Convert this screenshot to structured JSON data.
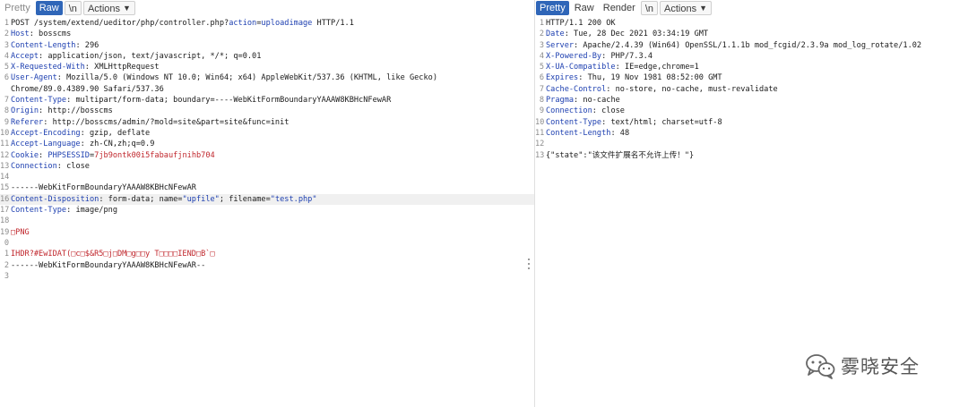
{
  "request": {
    "tabs": [
      "Pretty",
      "Raw",
      "\\n",
      "Actions"
    ],
    "active_tab": "Raw",
    "lines": [
      {
        "n": "1",
        "segs": [
          {
            "t": "POST /system/extend/ueditor/php/controller.php?"
          },
          {
            "t": "action",
            "c": "qv"
          },
          {
            "t": "="
          },
          {
            "t": "uploadimage",
            "c": "qv"
          },
          {
            "t": " HTTP/1.1"
          }
        ]
      },
      {
        "n": "2",
        "segs": [
          {
            "t": "Host",
            "c": "hn"
          },
          {
            "t": ": bosscms"
          }
        ]
      },
      {
        "n": "3",
        "segs": [
          {
            "t": "Content-Length",
            "c": "hn"
          },
          {
            "t": ": 296"
          }
        ]
      },
      {
        "n": "4",
        "segs": [
          {
            "t": "Accept",
            "c": "hn"
          },
          {
            "t": ": application/json, text/javascript, */*; q=0.01"
          }
        ]
      },
      {
        "n": "5",
        "segs": [
          {
            "t": "X-Requested-With",
            "c": "hn"
          },
          {
            "t": ": XMLHttpRequest"
          }
        ]
      },
      {
        "n": "6",
        "segs": [
          {
            "t": "User-Agent",
            "c": "hn"
          },
          {
            "t": ": Mozilla/5.0 (Windows NT 10.0; Win64; x64) AppleWebKit/537.36 (KHTML, like Gecko)"
          }
        ]
      },
      {
        "n": "",
        "segs": [
          {
            "t": "Chrome/89.0.4389.90 Safari/537.36"
          }
        ]
      },
      {
        "n": "7",
        "segs": [
          {
            "t": "Content-Type",
            "c": "hn"
          },
          {
            "t": ": multipart/form-data; boundary=----WebKitFormBoundaryYAAAW8KBHcNFewAR"
          }
        ]
      },
      {
        "n": "8",
        "segs": [
          {
            "t": "Origin",
            "c": "hn"
          },
          {
            "t": ": http://bosscms"
          }
        ]
      },
      {
        "n": "9",
        "segs": [
          {
            "t": "Referer",
            "c": "hn"
          },
          {
            "t": ": http://bosscms/admin/?mold=site&part=site&func=init"
          }
        ]
      },
      {
        "n": "10",
        "segs": [
          {
            "t": "Accept-Encoding",
            "c": "hn"
          },
          {
            "t": ": gzip, deflate"
          }
        ]
      },
      {
        "n": "11",
        "segs": [
          {
            "t": "Accept-Language",
            "c": "hn"
          },
          {
            "t": ": zh-CN,zh;q=0.9"
          }
        ]
      },
      {
        "n": "12",
        "segs": [
          {
            "t": "Cookie",
            "c": "hn"
          },
          {
            "t": ": "
          },
          {
            "t": "PHPSESSID",
            "c": "hn"
          },
          {
            "t": "="
          },
          {
            "t": "7jb9ontk00i5fabaufjnihb704",
            "c": "red"
          }
        ]
      },
      {
        "n": "13",
        "segs": [
          {
            "t": "Connection",
            "c": "hn"
          },
          {
            "t": ": close"
          }
        ]
      },
      {
        "n": "14",
        "segs": []
      },
      {
        "n": "15",
        "segs": [
          {
            "t": "------WebKitFormBoundaryYAAAW8KBHcNFewAR"
          }
        ]
      },
      {
        "n": "16",
        "hl": true,
        "segs": [
          {
            "t": "Content-Disposition",
            "c": "hn"
          },
          {
            "t": ": form-data; name="
          },
          {
            "t": "\"upfile\"",
            "c": "str"
          },
          {
            "t": "; filename="
          },
          {
            "t": "\"test.php\"",
            "c": "str"
          }
        ]
      },
      {
        "n": "17",
        "segs": [
          {
            "t": "Content-Type",
            "c": "hn"
          },
          {
            "t": ": image/png"
          }
        ]
      },
      {
        "n": "18",
        "segs": []
      },
      {
        "n": "19",
        "segs": [
          {
            "t": "□PNG",
            "c": "red"
          }
        ]
      },
      {
        "n": "0",
        "segs": []
      },
      {
        "n": "1",
        "segs": [
          {
            "t": "IHDR?#EwIDAT(□c□$&R5□j□DM□g□□y T□□□□IEND□B`□",
            "c": "red"
          }
        ]
      },
      {
        "n": "2",
        "segs": [
          {
            "t": "------WebKitFormBoundaryYAAAW8KBHcNFewAR--"
          }
        ]
      },
      {
        "n": "3",
        "segs": []
      }
    ]
  },
  "response": {
    "tabs": [
      "Pretty",
      "Raw",
      "Render",
      "\\n",
      "Actions"
    ],
    "active_tab": "Pretty",
    "lines": [
      {
        "n": "1",
        "segs": [
          {
            "t": "HTTP/1.1 200 OK"
          }
        ]
      },
      {
        "n": "2",
        "segs": [
          {
            "t": "Date",
            "c": "hn"
          },
          {
            "t": ": Tue, 28 Dec 2021 03:34:19 GMT"
          }
        ]
      },
      {
        "n": "3",
        "segs": [
          {
            "t": "Server",
            "c": "hn"
          },
          {
            "t": ": Apache/2.4.39 (Win64) OpenSSL/1.1.1b mod_fcgid/2.3.9a mod_log_rotate/1.02"
          }
        ]
      },
      {
        "n": "4",
        "segs": [
          {
            "t": "X-Powered-By",
            "c": "hn"
          },
          {
            "t": ": PHP/7.3.4"
          }
        ]
      },
      {
        "n": "5",
        "segs": [
          {
            "t": "X-UA-Compatible",
            "c": "hn"
          },
          {
            "t": ": IE=edge,chrome=1"
          }
        ]
      },
      {
        "n": "6",
        "segs": [
          {
            "t": "Expires",
            "c": "hn"
          },
          {
            "t": ": Thu, 19 Nov 1981 08:52:00 GMT"
          }
        ]
      },
      {
        "n": "7",
        "segs": [
          {
            "t": "Cache-Control",
            "c": "hn"
          },
          {
            "t": ": no-store, no-cache, must-revalidate"
          }
        ]
      },
      {
        "n": "8",
        "segs": [
          {
            "t": "Pragma",
            "c": "hn"
          },
          {
            "t": ": no-cache"
          }
        ]
      },
      {
        "n": "9",
        "segs": [
          {
            "t": "Connection",
            "c": "hn"
          },
          {
            "t": ": close"
          }
        ]
      },
      {
        "n": "10",
        "segs": [
          {
            "t": "Content-Type",
            "c": "hn"
          },
          {
            "t": ": text/html; charset=utf-8"
          }
        ]
      },
      {
        "n": "11",
        "segs": [
          {
            "t": "Content-Length",
            "c": "hn"
          },
          {
            "t": ": 48"
          }
        ]
      },
      {
        "n": "12",
        "segs": []
      },
      {
        "n": "13",
        "segs": [
          {
            "t": "{\"state\":\"该文件扩展名不允许上传！\"}"
          }
        ]
      }
    ]
  },
  "watermark": {
    "text": "雾晓安全",
    "icon": "wechat-icon"
  },
  "colors": {
    "active_tab": "#2f66b8",
    "header_name": "#1d3fb0",
    "value_red": "#c0262c"
  }
}
